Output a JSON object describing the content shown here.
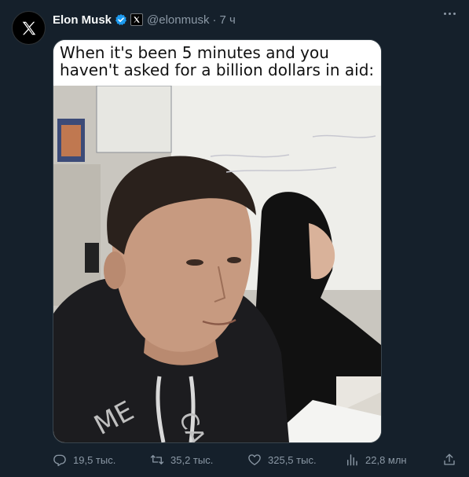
{
  "author": {
    "name": "Elon Musk",
    "handle": "@elonmusk",
    "time": "7 ч",
    "separator": "·"
  },
  "meme": {
    "caption_line1": "When it's been 5 minutes and you",
    "caption_line2": "haven't asked for a billion dollars in aid:"
  },
  "actions": {
    "replies": "19,5 тыс.",
    "reposts": "35,2 тыс.",
    "likes": "325,5 тыс.",
    "views": "22,8 млн"
  },
  "colors": {
    "background": "#15202b",
    "text_primary": "#f7f9f9",
    "text_secondary": "#8b98a5",
    "verified": "#1d9bf0"
  }
}
